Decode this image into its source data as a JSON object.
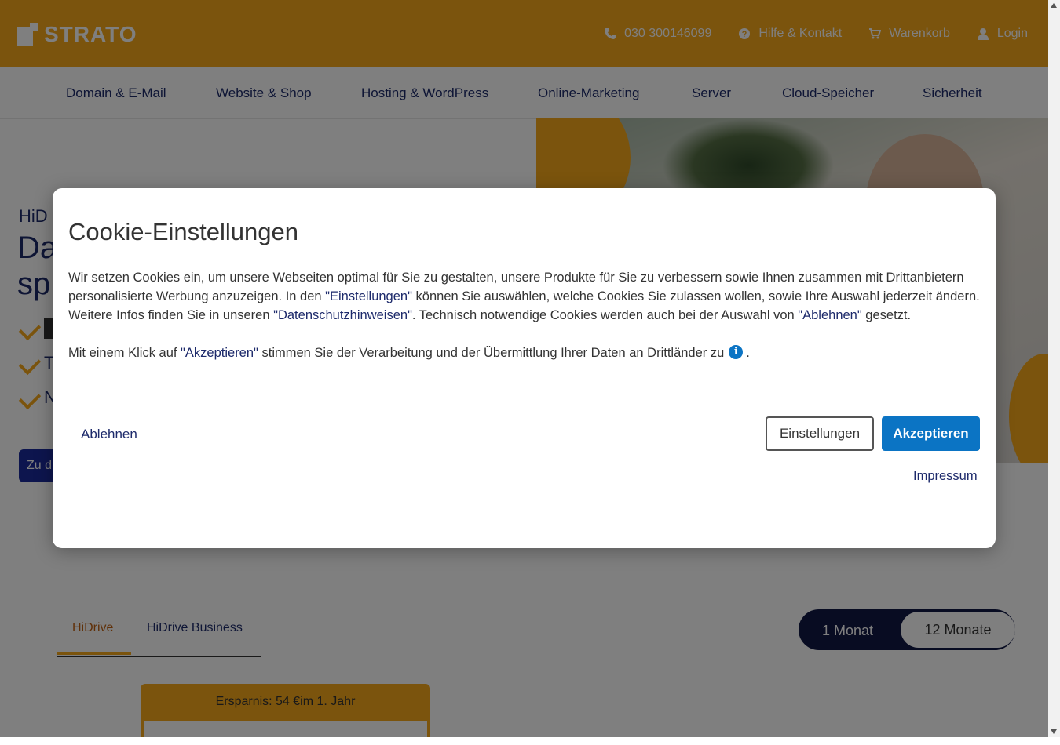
{
  "header": {
    "logo_text": "STRATO",
    "phone": "030 300146099",
    "help": "Hilfe & Kontakt",
    "cart": "Warenkorb",
    "login": "Login"
  },
  "nav": {
    "items": [
      "Domain & E-Mail",
      "Website & Shop",
      "Hosting & WordPress",
      "Online-Marketing",
      "Server",
      "Cloud-Speicher",
      "Sicherheit"
    ]
  },
  "hero": {
    "small": "HiD",
    "title_line1": "Da",
    "title_line2": "sp",
    "bullets": [
      "",
      "T",
      "N"
    ],
    "cta": "Zu d"
  },
  "tabs": [
    "HiDrive",
    "HiDrive Business"
  ],
  "billing_toggle": {
    "option1": "1 Monat",
    "option2": "12 Monate"
  },
  "savings_banner": "Ersparnis: 54 €im 1. Jahr",
  "cookie_modal": {
    "title": "Cookie-Einstellungen",
    "p1_a": "Wir setzen Cookies ein, um unsere Webseiten optimal für Sie zu gestalten, unsere Produkte für Sie zu verbessern sowie Ihnen zusammen mit Drittanbietern personalisierte Werbung anzuzeigen. In den ",
    "p1_link1": "\"Einstellungen\"",
    "p1_b": " können Sie auswählen, welche Cookies Sie zulassen wollen, sowie Ihre Auswahl jederzeit ändern. Weitere Infos finden Sie in unseren ",
    "p1_link2": "\"Datenschutzhinweisen\"",
    "p1_c": ". Technisch notwendige Cookies werden auch bei der Auswahl von ",
    "p1_link3": "\"Ablehnen\"",
    "p1_d": " gesetzt.",
    "p2_a": "Mit einem Klick auf ",
    "p2_link": "\"Akzeptieren\"",
    "p2_b": " stimmen Sie der Verarbeitung und der Übermittlung Ihrer Daten an Drittländer zu",
    "p2_end": ".",
    "reject": "Ablehnen",
    "settings": "Einstellungen",
    "accept": "Akzeptieren",
    "impressum": "Impressum"
  },
  "colors": {
    "brand_orange": "#f7a81a",
    "navy": "#1d2a6b",
    "accept_blue": "#0b74c4"
  }
}
